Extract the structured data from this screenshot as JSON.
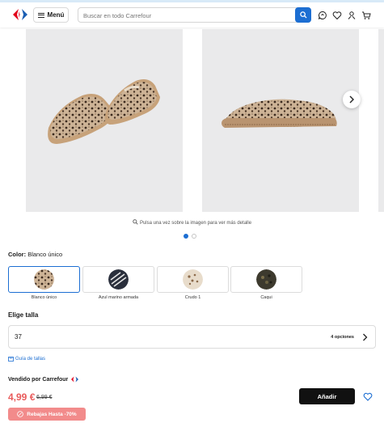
{
  "header": {
    "menu_label": "Menú",
    "search_placeholder": "Buscar en todo Carrefour"
  },
  "gallery": {
    "hint": "Pulsa una vez sobre la imagen para ver más detalle",
    "total_dots": 2,
    "active_dot": 1
  },
  "color": {
    "title": "Color:",
    "selected": "Blanco único",
    "options": [
      {
        "label": "Blanco único"
      },
      {
        "label": "Azul marino armada"
      },
      {
        "label": "Crudo 1"
      },
      {
        "label": "Caqui"
      }
    ]
  },
  "size": {
    "title": "Elige talla",
    "value": "37",
    "options_count": "4 opciones",
    "guide": "Guía de tallas"
  },
  "purchase": {
    "seller": "Vendido por Carrefour",
    "price": "4,99 €",
    "old_price": "6,99 €",
    "add_label": "Añadir",
    "promo": "Rebajas Hasta -70%"
  },
  "colors": {
    "accent": "#1c6ed2",
    "sale": "#e95b5b",
    "promo_bg": "#f28b8b",
    "brand_red": "#e2001a"
  }
}
